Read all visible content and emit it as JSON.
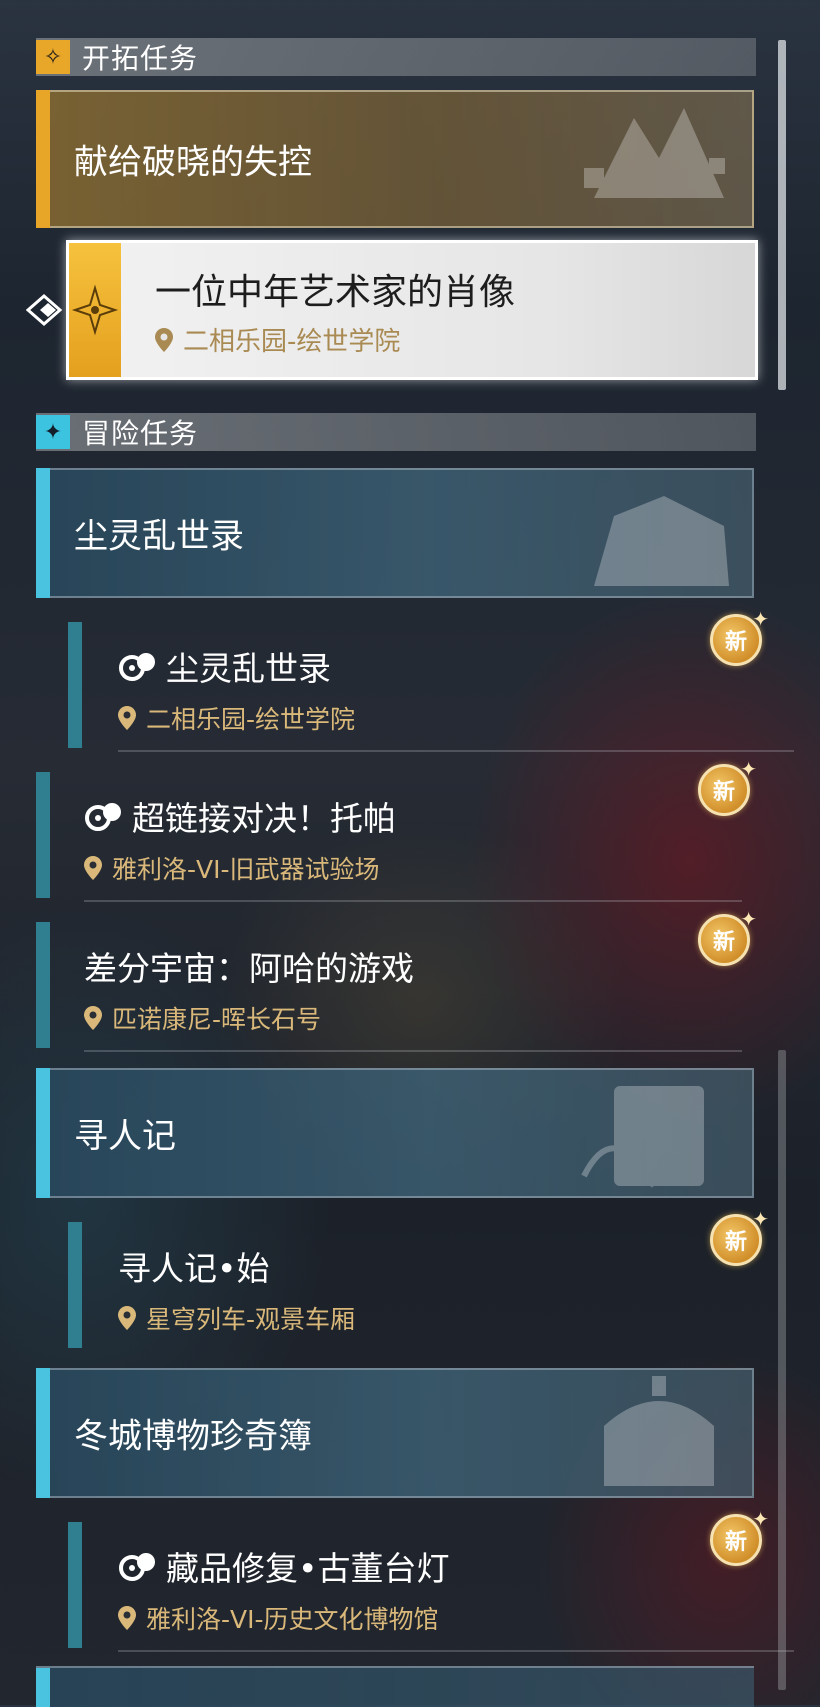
{
  "sections": {
    "trailblaze": {
      "title": "开拓任务"
    },
    "adventure": {
      "title": "冒险任务"
    }
  },
  "trailblaze_chapter": {
    "title": "献给破晓的失控"
  },
  "selected_quest": {
    "title": "一位中年艺术家的肖像",
    "location": "二相乐园-绘世学院"
  },
  "chapters": [
    {
      "title": "尘灵乱世录"
    },
    {
      "title": "寻人记"
    },
    {
      "title": "冬城博物珍奇簿"
    }
  ],
  "quests": [
    {
      "title": "尘灵乱世录",
      "location": "二相乐园-绘世学院",
      "badge": "新"
    },
    {
      "title": "超链接对决！托帕",
      "location": "雅利洛-VI-旧武器试验场",
      "badge": "新"
    },
    {
      "title": "差分宇宙：阿哈的游戏",
      "location": "匹诺康尼-晖长石号",
      "badge": "新"
    },
    {
      "title": "寻人记•始",
      "location": "星穹列车-观景车厢",
      "badge": "新"
    },
    {
      "title": "藏品修复•古董台灯",
      "location": "雅利洛-VI-历史文化博物馆",
      "badge": "新"
    }
  ],
  "icons": {
    "trailblaze_section": "compass-star-icon",
    "adventure_section": "four-point-star-icon",
    "selection_pointer": "diamond-pointer-icon",
    "location": "map-pin-icon",
    "quest_type": "activity-swirl-icon",
    "new_badge": "new-badge-icon"
  },
  "colors": {
    "trailblaze_accent": "#e8a628",
    "adventure_accent": "#49c3df",
    "location_text": "#d9b87a"
  }
}
